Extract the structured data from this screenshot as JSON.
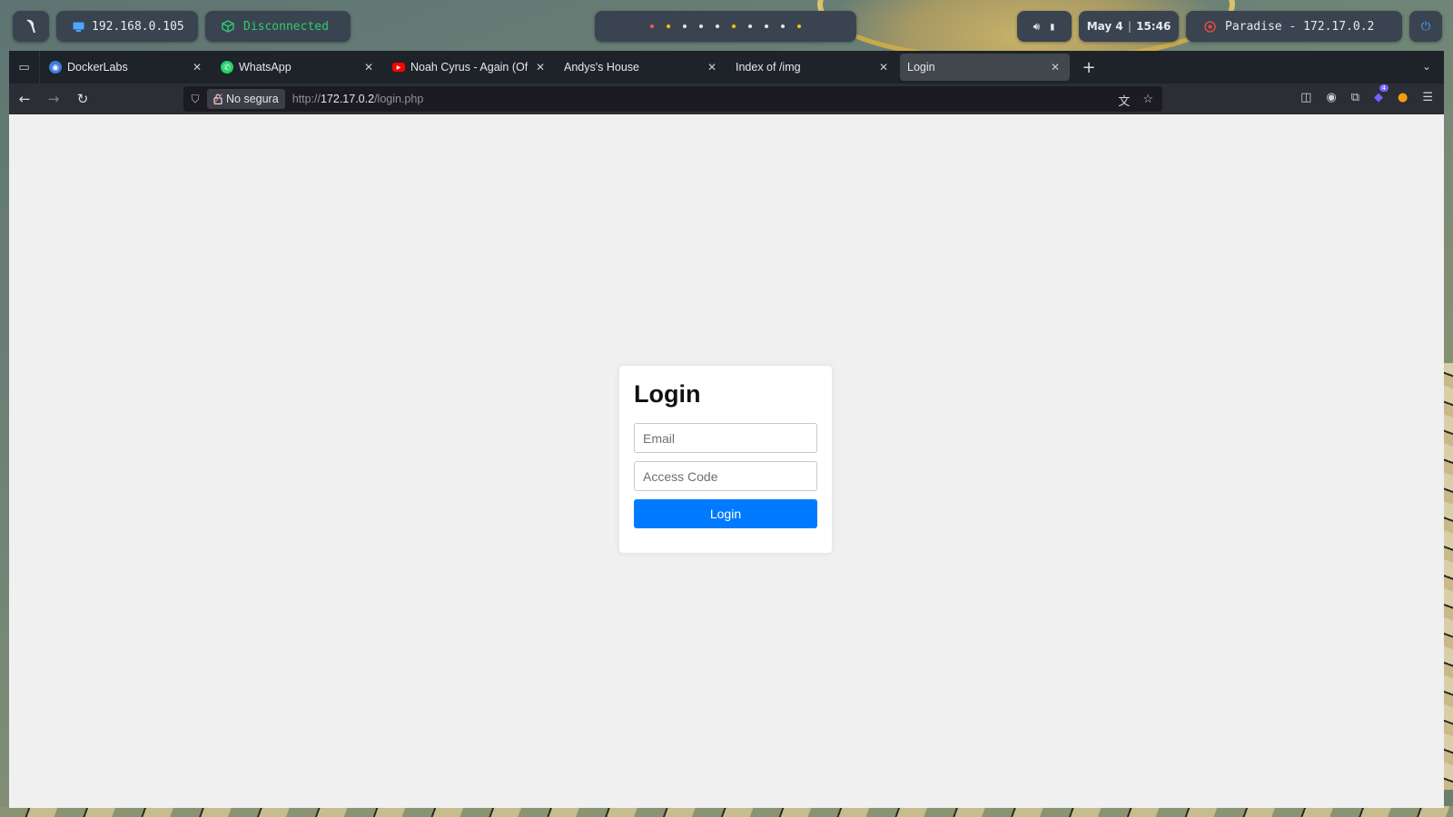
{
  "topbar": {
    "ip": "192.168.0.105",
    "vpn_status": "Disconnected",
    "date": "May 4",
    "time": "15:46",
    "target": "Paradise - 172.17.0.2",
    "workspace_colors": [
      "#ff5555",
      "#f1c40f",
      "#e6e9ee",
      "#e6e9ee",
      "#e6e9ee",
      "#f1c40f",
      "#e6e9ee",
      "#e6e9ee",
      "#e6e9ee",
      "#f1c40f"
    ]
  },
  "browser": {
    "tabs": [
      {
        "title": "DockerLabs",
        "icon": "docker-icon",
        "active": false
      },
      {
        "title": "WhatsApp",
        "icon": "whatsapp-icon",
        "active": false
      },
      {
        "title": "Noah Cyrus - Again (Offic",
        "icon": "youtube-icon",
        "active": false
      },
      {
        "title": "Andys's House",
        "icon": "",
        "active": false
      },
      {
        "title": "Index of /img",
        "icon": "",
        "active": false
      },
      {
        "title": "Login",
        "icon": "",
        "active": true
      }
    ],
    "security_label": "No segura",
    "url_prefix": "http://",
    "url_host": "172.17.0.2",
    "url_path": "/login.php",
    "extension_badge_count": "4"
  },
  "page": {
    "heading": "Login",
    "email_placeholder": "Email",
    "access_code_placeholder": "Access Code",
    "submit_label": "Login"
  }
}
